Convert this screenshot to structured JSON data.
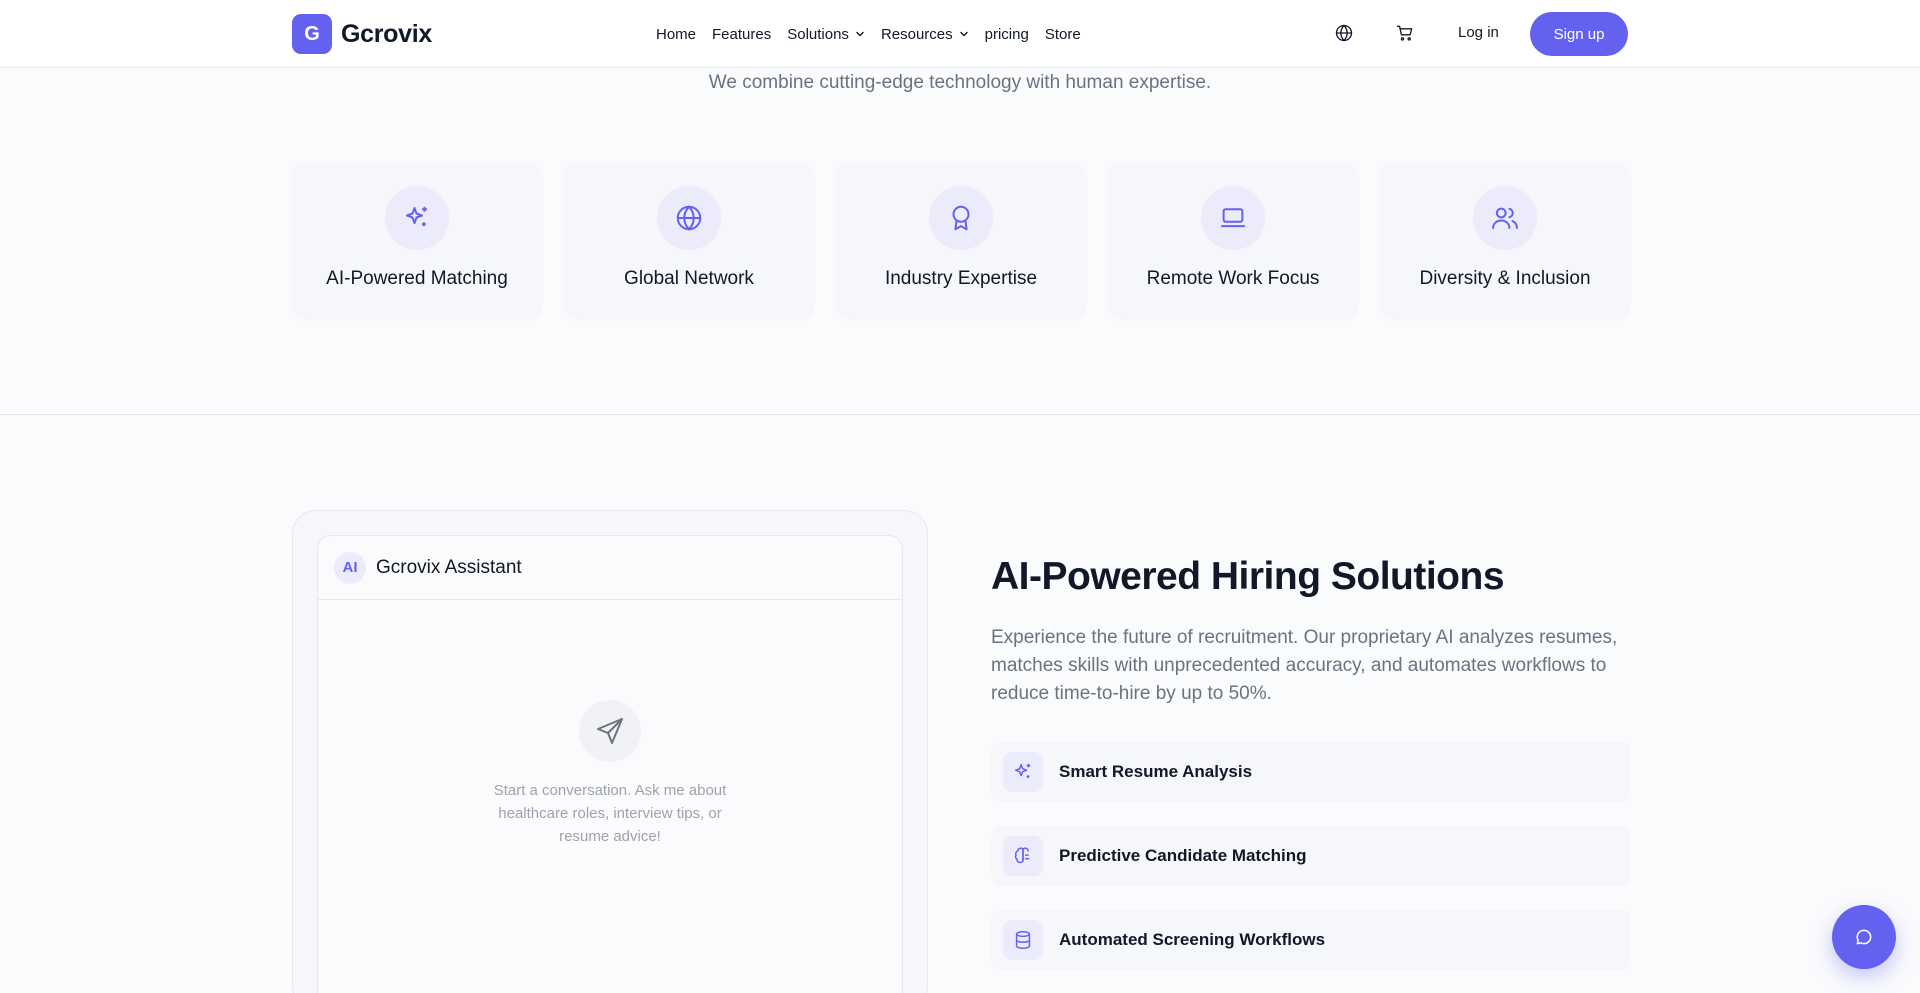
{
  "brand": {
    "logo_letter": "G",
    "name": "Gcrovix",
    "accent": "#6461f0"
  },
  "nav": {
    "items": [
      {
        "label": "Home",
        "has_dropdown": false
      },
      {
        "label": "Features",
        "has_dropdown": false
      },
      {
        "label": "Solutions",
        "has_dropdown": true
      },
      {
        "label": "Resources",
        "has_dropdown": true
      },
      {
        "label": "pricing",
        "has_dropdown": false
      },
      {
        "label": "Store",
        "has_dropdown": false
      }
    ]
  },
  "header": {
    "language_icon": "globe-icon",
    "cart_icon": "cart-icon",
    "login_label": "Log in",
    "signup_label": "Sign up"
  },
  "intro": {
    "subtitle": "We combine cutting-edge technology with human expertise."
  },
  "features": [
    {
      "label": "AI-Powered Matching",
      "icon": "sparkles-icon"
    },
    {
      "label": "Global Network",
      "icon": "globe-icon"
    },
    {
      "label": "Industry Expertise",
      "icon": "award-icon"
    },
    {
      "label": "Remote Work Focus",
      "icon": "laptop-icon"
    },
    {
      "label": "Diversity & Inclusion",
      "icon": "users-icon"
    }
  ],
  "assistant": {
    "badge": "AI",
    "title": "Gcrovix Assistant",
    "empty_icon": "send-icon",
    "empty_text": "Start a conversation. Ask me about healthcare roles, interview tips, or resume advice!"
  },
  "solutions": {
    "title": "AI-Powered Hiring Solutions",
    "description": "Experience the future of recruitment. Our proprietary AI analyzes resumes, matches skills with unprecedented accuracy, and automates workflows to reduce time-to-hire by up to 50%.",
    "items": [
      {
        "label": "Smart Resume Analysis",
        "icon": "sparkles-icon"
      },
      {
        "label": "Predictive Candidate Matching",
        "icon": "brain-icon"
      },
      {
        "label": "Automated Screening Workflows",
        "icon": "database-icon"
      }
    ]
  },
  "chat_fab": {
    "icon": "chat-bubble-icon"
  }
}
